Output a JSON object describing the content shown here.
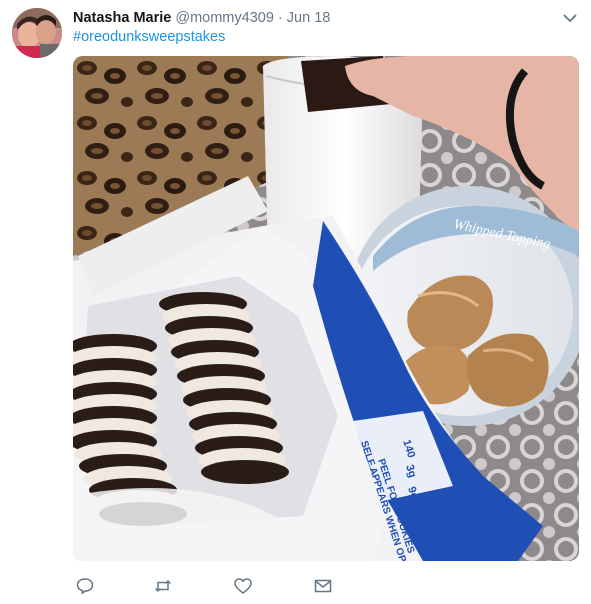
{
  "tweet": {
    "author_name": "Natasha Marie",
    "handle": "@mommy4309",
    "separator": " · ",
    "date": "Jun 18",
    "hashtag": "#oreodunksweepstakes"
  },
  "photo": {
    "tub_label": "Whipped Topping",
    "pack_text_1": "SELF APPEARS WHEN OPENED",
    "pack_text_2": "PEEL FOR COOKIES",
    "nutrition_1": "140",
    "nutrition_2": "3g",
    "nutrition_3": "9g"
  },
  "icons": {
    "caret": "chevron-down-icon",
    "reply": "reply-icon",
    "retweet": "retweet-icon",
    "like": "heart-icon",
    "dm": "envelope-icon"
  },
  "colors": {
    "link": "#1b95e0",
    "muted": "#657786",
    "text": "#14171a",
    "oreo_blue": "#1f4fb4"
  }
}
